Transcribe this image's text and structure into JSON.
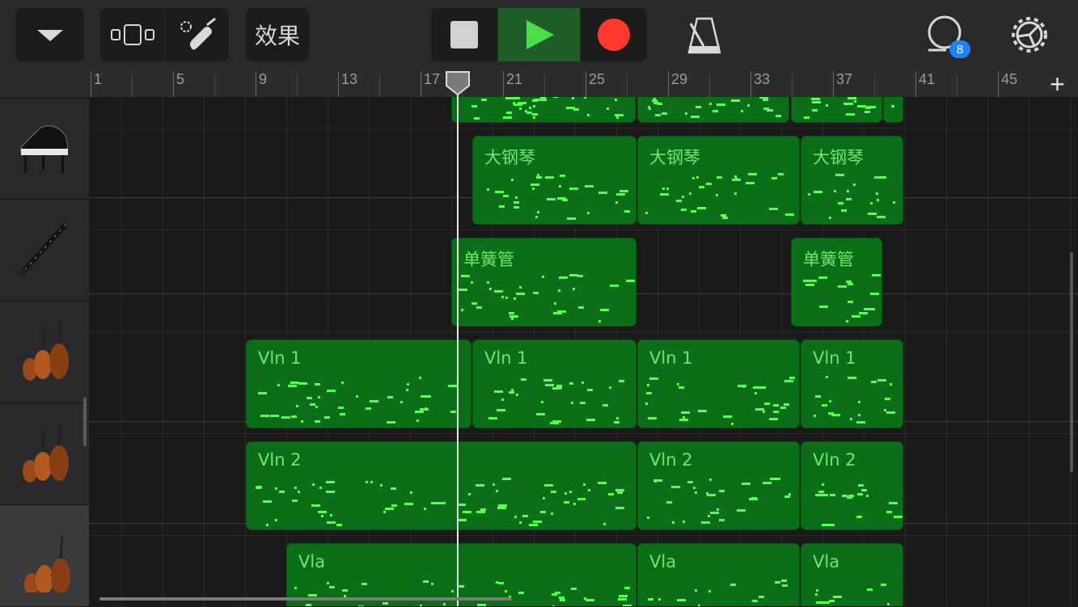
{
  "toolbar": {
    "fx_label": "效果",
    "loop_badge": "8",
    "icons": {
      "menu": "chevron-down-icon",
      "views": "track-view-icon",
      "instrument": "smart-controls-icon",
      "stop": "stop-icon",
      "play": "play-icon",
      "record": "record-icon",
      "metronome": "metronome-icon",
      "loops": "loop-browser-icon",
      "settings": "gear-icon"
    }
  },
  "ruler": {
    "bar_numbers": [
      "1",
      "5",
      "9",
      "13",
      "17",
      "21",
      "25",
      "29",
      "33",
      "37",
      "41",
      "45"
    ],
    "add_track": "+"
  },
  "tracks": [
    {
      "instrument": "piano-icon",
      "regions": []
    },
    {
      "instrument": "grand-piano-icon",
      "regions": [
        {
          "name": "大钢琴"
        },
        {
          "name": "大钢琴"
        },
        {
          "name": "大钢琴"
        }
      ]
    },
    {
      "instrument": "clarinet-icon",
      "regions": [
        {
          "name": "单簧管"
        },
        {
          "name": "单簧管"
        }
      ]
    },
    {
      "instrument": "violins-icon",
      "regions": [
        {
          "name": "Vln 1"
        },
        {
          "name": "Vln 1"
        },
        {
          "name": "Vln 1"
        },
        {
          "name": "Vln 1"
        }
      ]
    },
    {
      "instrument": "violins-icon",
      "regions": [
        {
          "name": "Vln 2"
        },
        {
          "name": "Vln 2"
        },
        {
          "name": "Vln 2"
        }
      ]
    },
    {
      "instrument": "violas-icon",
      "regions": [
        {
          "name": "Vla"
        },
        {
          "name": "Vla"
        },
        {
          "name": "Vla"
        }
      ]
    }
  ],
  "colors": {
    "region_fill": "#0d6e1a",
    "note": "#58ff58",
    "region_text": "#6ee86e",
    "play_active": "#1f6e2a",
    "record": "#ff3b30",
    "badge": "#1a84ff"
  }
}
